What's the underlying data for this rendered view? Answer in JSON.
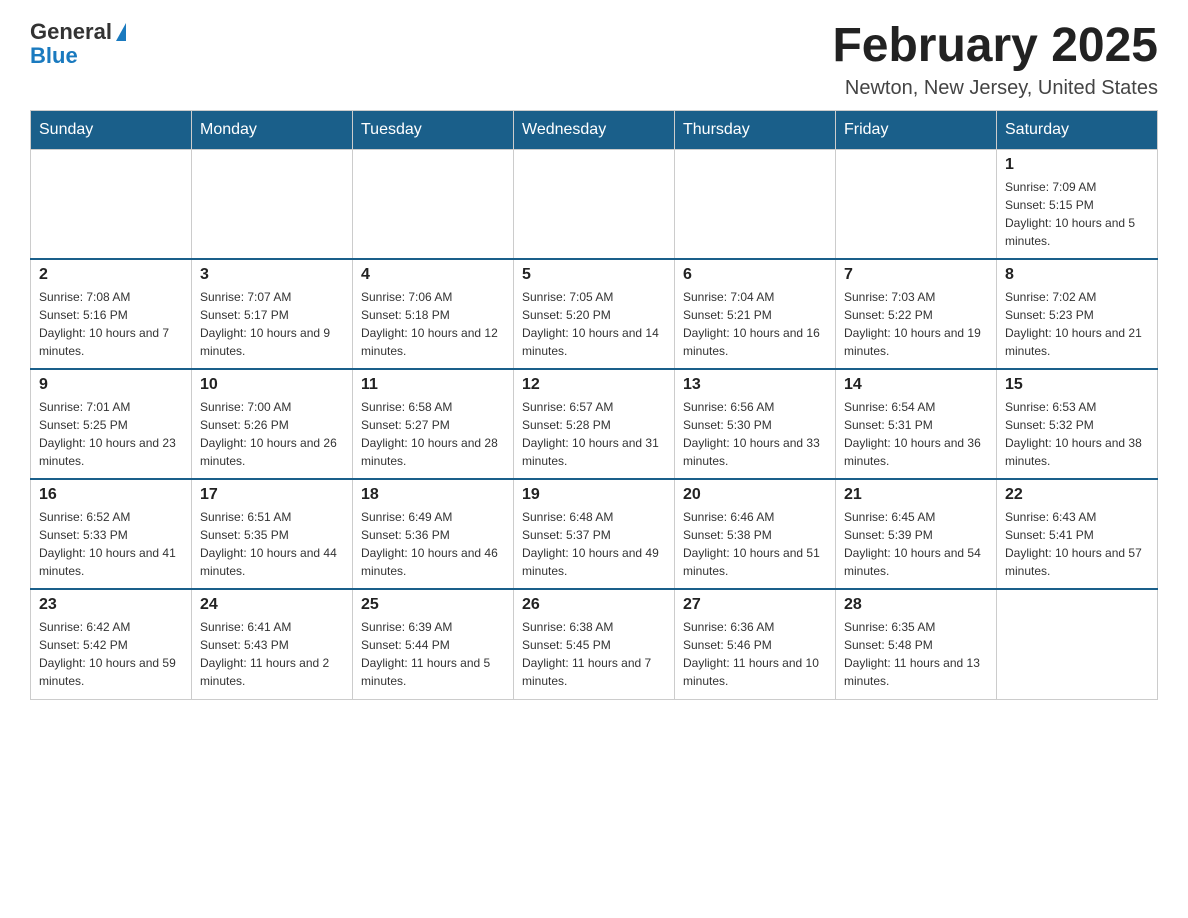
{
  "logo": {
    "general": "General",
    "blue": "Blue"
  },
  "title": "February 2025",
  "location": "Newton, New Jersey, United States",
  "days_of_week": [
    "Sunday",
    "Monday",
    "Tuesday",
    "Wednesday",
    "Thursday",
    "Friday",
    "Saturday"
  ],
  "weeks": [
    [
      {
        "day": "",
        "info": ""
      },
      {
        "day": "",
        "info": ""
      },
      {
        "day": "",
        "info": ""
      },
      {
        "day": "",
        "info": ""
      },
      {
        "day": "",
        "info": ""
      },
      {
        "day": "",
        "info": ""
      },
      {
        "day": "1",
        "info": "Sunrise: 7:09 AM\nSunset: 5:15 PM\nDaylight: 10 hours and 5 minutes."
      }
    ],
    [
      {
        "day": "2",
        "info": "Sunrise: 7:08 AM\nSunset: 5:16 PM\nDaylight: 10 hours and 7 minutes."
      },
      {
        "day": "3",
        "info": "Sunrise: 7:07 AM\nSunset: 5:17 PM\nDaylight: 10 hours and 9 minutes."
      },
      {
        "day": "4",
        "info": "Sunrise: 7:06 AM\nSunset: 5:18 PM\nDaylight: 10 hours and 12 minutes."
      },
      {
        "day": "5",
        "info": "Sunrise: 7:05 AM\nSunset: 5:20 PM\nDaylight: 10 hours and 14 minutes."
      },
      {
        "day": "6",
        "info": "Sunrise: 7:04 AM\nSunset: 5:21 PM\nDaylight: 10 hours and 16 minutes."
      },
      {
        "day": "7",
        "info": "Sunrise: 7:03 AM\nSunset: 5:22 PM\nDaylight: 10 hours and 19 minutes."
      },
      {
        "day": "8",
        "info": "Sunrise: 7:02 AM\nSunset: 5:23 PM\nDaylight: 10 hours and 21 minutes."
      }
    ],
    [
      {
        "day": "9",
        "info": "Sunrise: 7:01 AM\nSunset: 5:25 PM\nDaylight: 10 hours and 23 minutes."
      },
      {
        "day": "10",
        "info": "Sunrise: 7:00 AM\nSunset: 5:26 PM\nDaylight: 10 hours and 26 minutes."
      },
      {
        "day": "11",
        "info": "Sunrise: 6:58 AM\nSunset: 5:27 PM\nDaylight: 10 hours and 28 minutes."
      },
      {
        "day": "12",
        "info": "Sunrise: 6:57 AM\nSunset: 5:28 PM\nDaylight: 10 hours and 31 minutes."
      },
      {
        "day": "13",
        "info": "Sunrise: 6:56 AM\nSunset: 5:30 PM\nDaylight: 10 hours and 33 minutes."
      },
      {
        "day": "14",
        "info": "Sunrise: 6:54 AM\nSunset: 5:31 PM\nDaylight: 10 hours and 36 minutes."
      },
      {
        "day": "15",
        "info": "Sunrise: 6:53 AM\nSunset: 5:32 PM\nDaylight: 10 hours and 38 minutes."
      }
    ],
    [
      {
        "day": "16",
        "info": "Sunrise: 6:52 AM\nSunset: 5:33 PM\nDaylight: 10 hours and 41 minutes."
      },
      {
        "day": "17",
        "info": "Sunrise: 6:51 AM\nSunset: 5:35 PM\nDaylight: 10 hours and 44 minutes."
      },
      {
        "day": "18",
        "info": "Sunrise: 6:49 AM\nSunset: 5:36 PM\nDaylight: 10 hours and 46 minutes."
      },
      {
        "day": "19",
        "info": "Sunrise: 6:48 AM\nSunset: 5:37 PM\nDaylight: 10 hours and 49 minutes."
      },
      {
        "day": "20",
        "info": "Sunrise: 6:46 AM\nSunset: 5:38 PM\nDaylight: 10 hours and 51 minutes."
      },
      {
        "day": "21",
        "info": "Sunrise: 6:45 AM\nSunset: 5:39 PM\nDaylight: 10 hours and 54 minutes."
      },
      {
        "day": "22",
        "info": "Sunrise: 6:43 AM\nSunset: 5:41 PM\nDaylight: 10 hours and 57 minutes."
      }
    ],
    [
      {
        "day": "23",
        "info": "Sunrise: 6:42 AM\nSunset: 5:42 PM\nDaylight: 10 hours and 59 minutes."
      },
      {
        "day": "24",
        "info": "Sunrise: 6:41 AM\nSunset: 5:43 PM\nDaylight: 11 hours and 2 minutes."
      },
      {
        "day": "25",
        "info": "Sunrise: 6:39 AM\nSunset: 5:44 PM\nDaylight: 11 hours and 5 minutes."
      },
      {
        "day": "26",
        "info": "Sunrise: 6:38 AM\nSunset: 5:45 PM\nDaylight: 11 hours and 7 minutes."
      },
      {
        "day": "27",
        "info": "Sunrise: 6:36 AM\nSunset: 5:46 PM\nDaylight: 11 hours and 10 minutes."
      },
      {
        "day": "28",
        "info": "Sunrise: 6:35 AM\nSunset: 5:48 PM\nDaylight: 11 hours and 13 minutes."
      },
      {
        "day": "",
        "info": ""
      }
    ]
  ]
}
